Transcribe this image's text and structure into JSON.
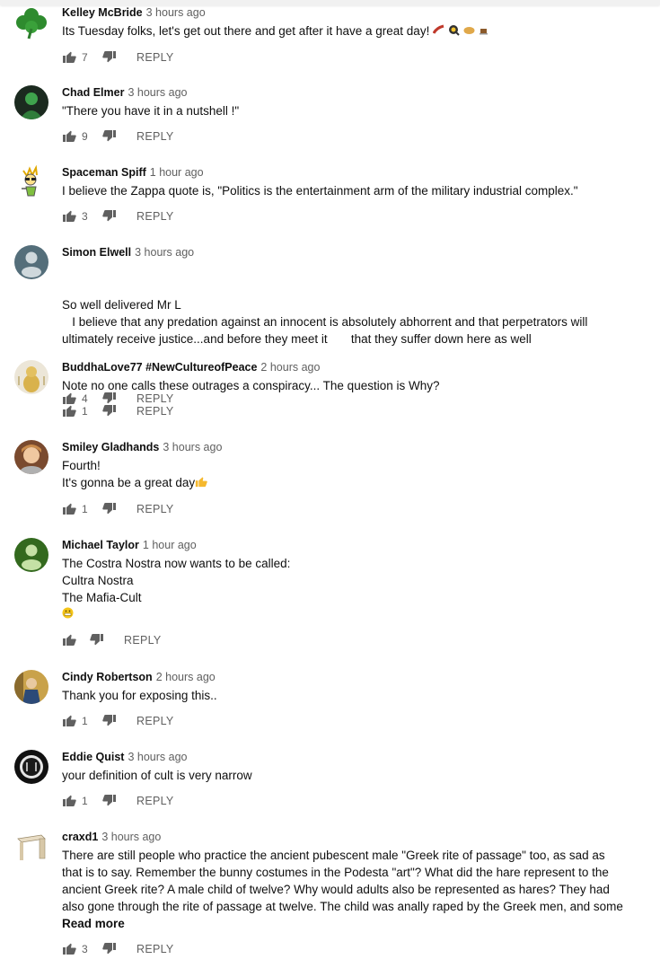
{
  "reply_label": "REPLY",
  "read_more_label": "Read more",
  "comments": [
    {
      "author": "Kelley McBride",
      "time": "3 hours ago",
      "lines": [
        "Its Tuesday folks, let's get out there and get after it have a great day!"
      ],
      "likes": "7"
    },
    {
      "author": "Chad Elmer",
      "time": "3 hours ago",
      "lines": [
        "\"There you have it in a nutshell !\""
      ],
      "likes": "9"
    },
    {
      "author": "Spaceman Spiff",
      "time": "1 hour ago",
      "lines": [
        "I believe the Zappa quote is, \"Politics is the entertainment arm of the military industrial complex.\""
      ],
      "likes": "3"
    },
    {
      "author": "Simon Elwell",
      "time": "3 hours ago",
      "lines": [
        "So well delivered Mr L",
        "   I believe that any predation against an innocent is absolutely abhorrent and that perpetrators will",
        "ultimately receive justice...and before they meet it       that they suffer down here as well"
      ],
      "likes": "4"
    },
    {
      "author": "BuddhaLove77 #NewCultureofPeace",
      "time": "2 hours ago",
      "lines": [
        "Note no one calls these outrages a conspiracy... The question is Why?"
      ],
      "likes": "1"
    },
    {
      "author": "Smiley Gladhands",
      "time": "3 hours ago",
      "lines": [
        "Fourth!",
        "It's gonna be a great day"
      ],
      "likes": "1"
    },
    {
      "author": "Michael Taylor",
      "time": "1 hour ago",
      "lines": [
        "The Costra Nostra now wants to be called:",
        "Cultra Nostra",
        "The Mafia-Cult"
      ],
      "likes": ""
    },
    {
      "author": "Cindy Robertson",
      "time": "2 hours ago",
      "lines": [
        "Thank you for exposing this.."
      ],
      "likes": "1"
    },
    {
      "author": "Eddie Quist",
      "time": "3 hours ago",
      "lines": [
        "your definition of cult is very narrow"
      ],
      "likes": "1"
    },
    {
      "author": "craxd1",
      "time": "3 hours ago",
      "lines": [
        "There are still people who practice the ancient pubescent male \"Greek rite of passage\" too, as sad as",
        "that is to say. Remember the bunny costumes in the Podesta \"art\"? What did the hare represent to the",
        "ancient Greek rite? A male child of twelve? Why would adults also be represented as hares? They had",
        "also gone through the rite of passage at twelve. The child was anally raped by the Greek men, and some"
      ],
      "likes": "3"
    }
  ]
}
